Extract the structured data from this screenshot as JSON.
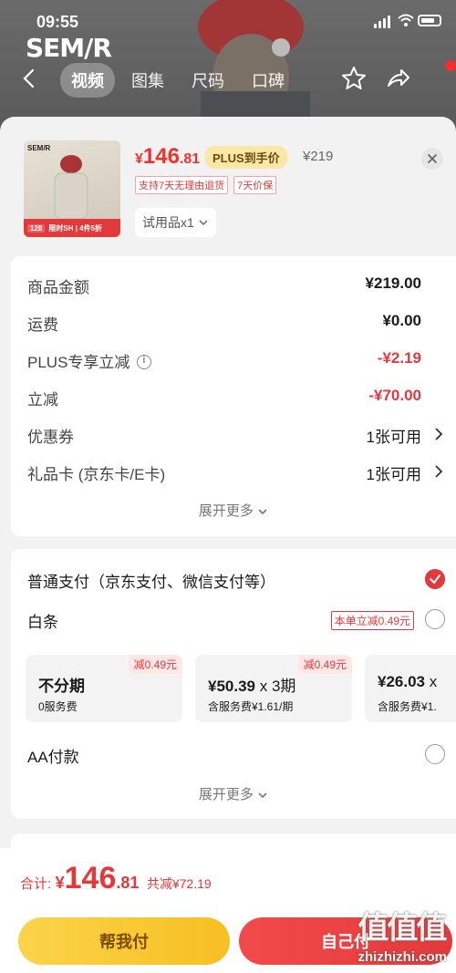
{
  "status_bar": {
    "time": "09:55"
  },
  "background_page": {
    "brand": "SEM/R",
    "tabs": [
      {
        "label": "视频",
        "active": true
      },
      {
        "label": "图集",
        "active": false
      },
      {
        "label": "尺码",
        "active": false
      },
      {
        "label": "口碑",
        "active": false
      }
    ]
  },
  "product": {
    "thumbnail_brand": "SEM/R",
    "thumbnail_banner_price": "128",
    "thumbnail_banner_text": "限时SH | 4件5折",
    "price_currency": "¥",
    "price_int": "146",
    "price_dec": ".81",
    "plus_badge": "PLUS到手价",
    "original_price": "¥219",
    "tags": [
      "支持7天无理由退货",
      "7天价保"
    ],
    "variant": "试用品x1"
  },
  "summary": {
    "rows": [
      {
        "label": "商品金额",
        "value": "¥219.00"
      },
      {
        "label": "运费",
        "value": "¥0.00"
      },
      {
        "label": "PLUS专享立减",
        "value": "-¥2.19"
      },
      {
        "label": "立减",
        "value": "-¥70.00"
      },
      {
        "label": "优惠券",
        "value": "1张可用"
      },
      {
        "label": "礼品卡 (京东卡/E卡)",
        "value": "1张可用"
      }
    ],
    "more": "展开更多"
  },
  "payment": {
    "normal": "普通支付（京东支付、微信支付等）",
    "baitiao": "白条",
    "baitiao_promo": "本单立减0.49元",
    "plans": [
      {
        "main": "不分期",
        "sub": "0服务费",
        "discount": "减0.49元"
      },
      {
        "main": "¥50.39",
        "times": "x 3期",
        "sub": "含服务费¥1.61/期",
        "discount": "减0.49元"
      },
      {
        "main": "¥26.03",
        "times": "x",
        "sub": "含服务费¥1.",
        "discount": ""
      }
    ],
    "aa": "AA付款",
    "more": "展开更多"
  },
  "footer": {
    "total_label": "合计:",
    "currency": "¥",
    "total_int": "146",
    "total_dec": ".81",
    "saved": "共减¥72.19",
    "help_pay": "帮我付",
    "pay_button": "自己付"
  },
  "watermark": {
    "logo": "值值值",
    "url": "zhizhizhi.com"
  },
  "colors": {
    "accent_red": "#e4393c",
    "help_button": "#f7bf22"
  }
}
